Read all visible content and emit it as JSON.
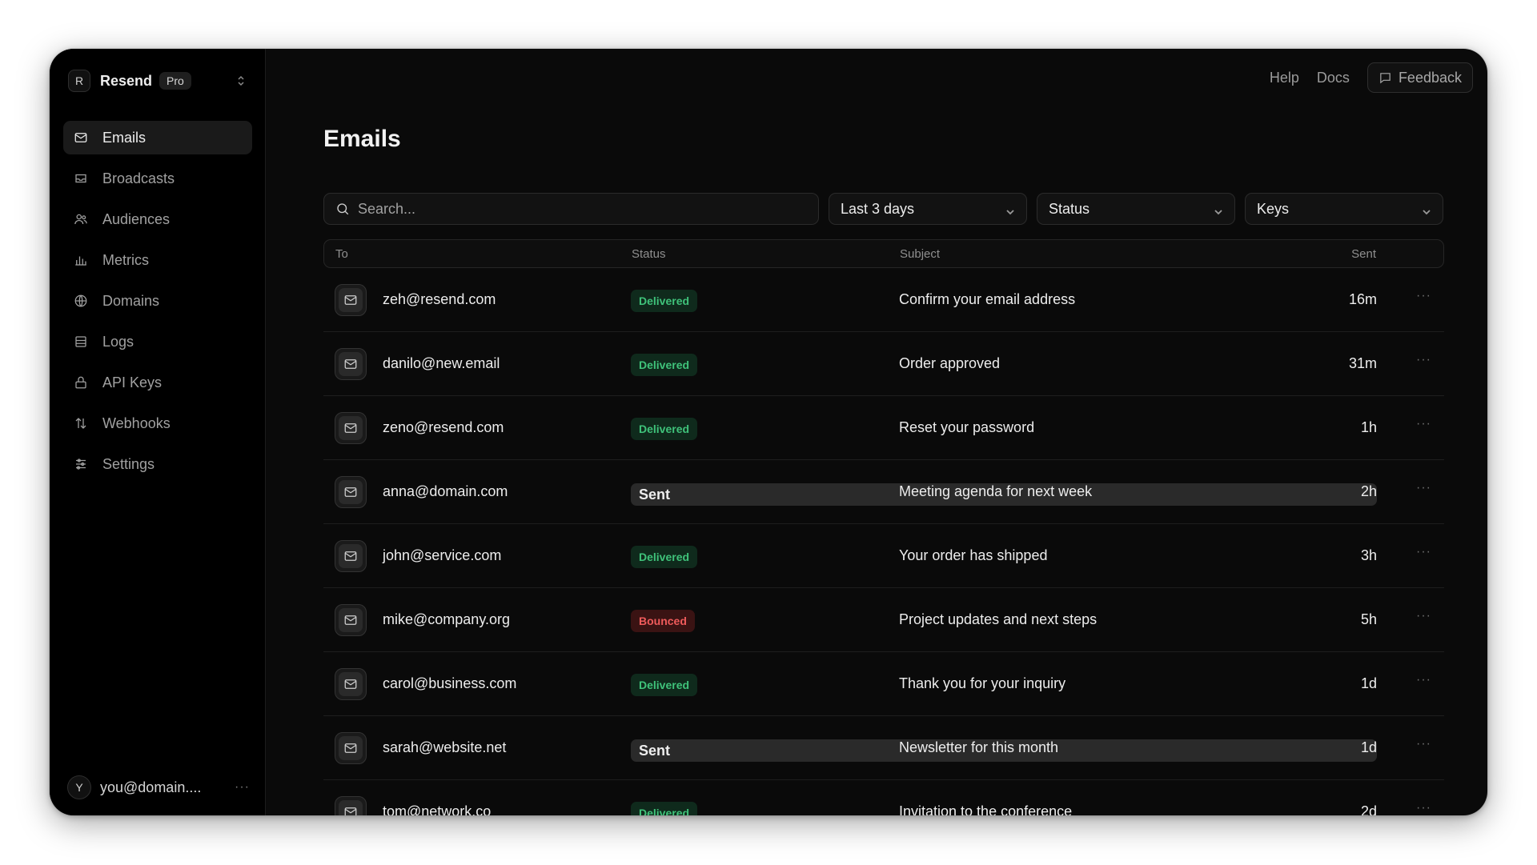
{
  "team": {
    "avatar_letter": "R",
    "name": "Resend",
    "plan": "Pro"
  },
  "nav": {
    "items": [
      {
        "label": "Emails",
        "icon": "mail-icon",
        "active": true
      },
      {
        "label": "Broadcasts",
        "icon": "broadcast-icon",
        "active": false
      },
      {
        "label": "Audiences",
        "icon": "users-icon",
        "active": false
      },
      {
        "label": "Metrics",
        "icon": "bar-chart-icon",
        "active": false
      },
      {
        "label": "Domains",
        "icon": "globe-icon",
        "active": false
      },
      {
        "label": "Logs",
        "icon": "logs-icon",
        "active": false
      },
      {
        "label": "API Keys",
        "icon": "lock-icon",
        "active": false
      },
      {
        "label": "Webhooks",
        "icon": "arrows-icon",
        "active": false
      },
      {
        "label": "Settings",
        "icon": "sliders-icon",
        "active": false
      }
    ]
  },
  "user": {
    "avatar_letter": "Y",
    "email": "you@domain....",
    "more": "···"
  },
  "topbar": {
    "help": "Help",
    "docs": "Docs",
    "feedback": "Feedback"
  },
  "page": {
    "title": "Emails"
  },
  "filters": {
    "search_placeholder": "Search...",
    "date_range": "Last 3 days",
    "status": "Status",
    "keys": "Keys"
  },
  "table": {
    "columns": {
      "to": "To",
      "status": "Status",
      "subject": "Subject",
      "sent": "Sent"
    },
    "rows": [
      {
        "to": "zeh@resend.com",
        "status": "Delivered",
        "subject": "Confirm your email address",
        "sent": "16m"
      },
      {
        "to": "danilo@new.email",
        "status": "Delivered",
        "subject": "Order approved",
        "sent": "31m"
      },
      {
        "to": "zeno@resend.com",
        "status": "Delivered",
        "subject": "Reset your password",
        "sent": "1h"
      },
      {
        "to": "anna@domain.com",
        "status": "Sent",
        "subject": "Meeting agenda for next week",
        "sent": "2h"
      },
      {
        "to": "john@service.com",
        "status": "Delivered",
        "subject": "Your order has shipped",
        "sent": "3h"
      },
      {
        "to": "mike@company.org",
        "status": "Bounced",
        "subject": "Project updates and next steps",
        "sent": "5h"
      },
      {
        "to": "carol@business.com",
        "status": "Delivered",
        "subject": "Thank you for your inquiry",
        "sent": "1d"
      },
      {
        "to": "sarah@website.net",
        "status": "Sent",
        "subject": "Newsletter for this month",
        "sent": "1d"
      },
      {
        "to": "tom@network.co",
        "status": "Delivered",
        "subject": "Invitation to the conference",
        "sent": "2d"
      }
    ],
    "row_more": "···"
  },
  "colors": {
    "background": "#0a0a0a",
    "sidebar": "#000000",
    "delivered": "#3fc27a",
    "bounced": "#ef5b5b",
    "sent": "#cfcfcf"
  }
}
